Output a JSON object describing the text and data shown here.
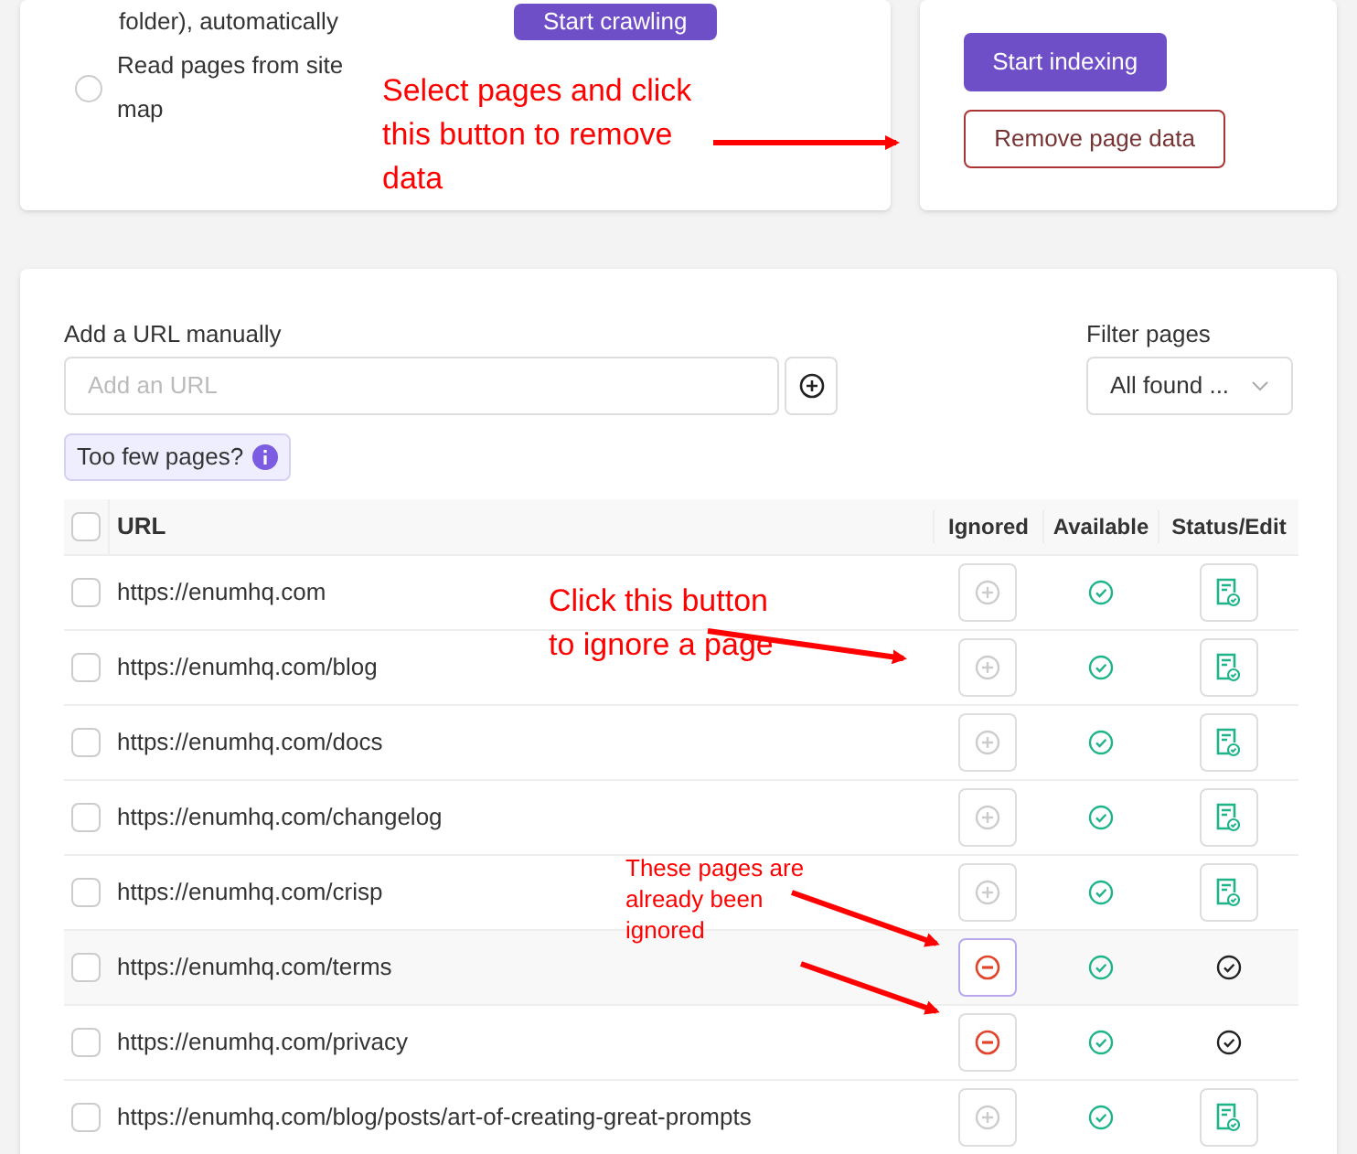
{
  "crawl_card": {
    "option_text_cut": "folder), automatically",
    "radio_option": {
      "label": "Read pages from site map",
      "selected": false
    },
    "start_button": "Start crawling"
  },
  "index_card": {
    "start_button": "Start indexing",
    "remove_button": "Remove page data"
  },
  "add_url": {
    "label": "Add a URL manually",
    "placeholder": "Add an URL"
  },
  "filter": {
    "label": "Filter pages",
    "value": "All found ..."
  },
  "hint_badge": "Too few pages?",
  "table": {
    "columns": [
      "URL",
      "Ignored",
      "Available",
      "Status/Edit"
    ],
    "all_checked": false,
    "rows": [
      {
        "url": "https://enumhq.com",
        "checked": false,
        "ignored": false,
        "highlighted": false
      },
      {
        "url": "https://enumhq.com/blog",
        "checked": false,
        "ignored": false,
        "highlighted": false
      },
      {
        "url": "https://enumhq.com/docs",
        "checked": false,
        "ignored": false,
        "highlighted": false
      },
      {
        "url": "https://enumhq.com/changelog",
        "checked": false,
        "ignored": false,
        "highlighted": false
      },
      {
        "url": "https://enumhq.com/crisp",
        "checked": false,
        "ignored": false,
        "highlighted": false
      },
      {
        "url": "https://enumhq.com/terms",
        "checked": false,
        "ignored": true,
        "highlighted": true
      },
      {
        "url": "https://enumhq.com/privacy",
        "checked": false,
        "ignored": true,
        "highlighted": false
      },
      {
        "url": "https://enumhq.com/blog/posts/art-of-creating-great-prompts",
        "checked": false,
        "ignored": false,
        "highlighted": false
      }
    ]
  },
  "annotations": [
    {
      "text": "Select pages and click this button to remove data"
    },
    {
      "text": "Click this button to ignore a page"
    },
    {
      "text": "These pages are already been ignored"
    }
  ]
}
